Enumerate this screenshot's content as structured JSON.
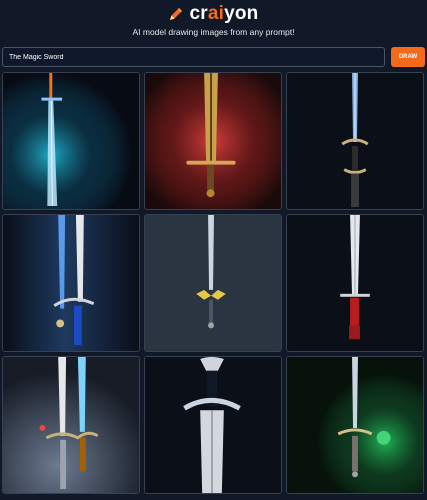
{
  "header": {
    "brand_left": "cr",
    "brand_mid": "ai",
    "brand_right": "yon",
    "tagline": "AI model drawing images from any prompt!",
    "icon": "pencil-icon"
  },
  "prompt": {
    "value": "The Magic Sword",
    "button_label": "DRAW"
  },
  "colors": {
    "accent": "#f46a1b",
    "background": "#111827"
  },
  "gallery": {
    "images": [
      "glowing-blue-sword",
      "golden-sword-red-glow",
      "silver-sword-dark",
      "twin-blades-blue",
      "sword-yellow-guard",
      "sword-red-handle",
      "sword-smoke",
      "broad-sword-dark",
      "sword-green-glow"
    ]
  }
}
